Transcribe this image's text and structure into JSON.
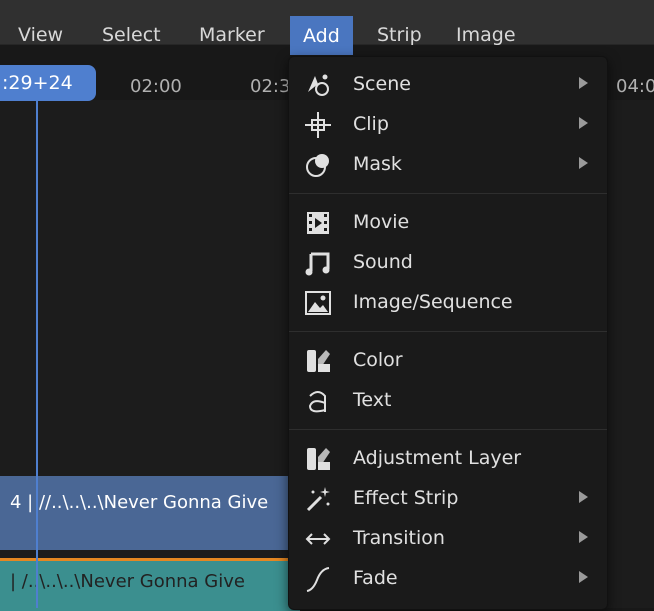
{
  "menubar": {
    "items": [
      "View",
      "Select",
      "Marker",
      "Add",
      "Strip",
      "Image"
    ],
    "active_index": 3
  },
  "timeline": {
    "playhead_time": ":29+24",
    "ticks": [
      "02:00",
      "02:3"
    ],
    "right_tick": "04:0"
  },
  "strips": {
    "movie_label": "4 | //..\\..\\..\\Never Gonna Give",
    "sound_label": "| /..\\..\\..\\Never Gonna Give"
  },
  "add_menu": {
    "groups": [
      [
        {
          "label": "Scene",
          "icon": "scene-icon",
          "submenu": true
        },
        {
          "label": "Clip",
          "icon": "clip-icon",
          "submenu": true
        },
        {
          "label": "Mask",
          "icon": "mask-icon",
          "submenu": true
        }
      ],
      [
        {
          "label": "Movie",
          "icon": "movie-icon",
          "submenu": false
        },
        {
          "label": "Sound",
          "icon": "sound-icon",
          "submenu": false
        },
        {
          "label": "Image/Sequence",
          "icon": "image-icon",
          "submenu": false
        }
      ],
      [
        {
          "label": "Color",
          "icon": "color-icon",
          "submenu": false
        },
        {
          "label": "Text",
          "icon": "text-icon",
          "submenu": false
        }
      ],
      [
        {
          "label": "Adjustment Layer",
          "icon": "adjustment-layer-icon",
          "submenu": false
        },
        {
          "label": "Effect Strip",
          "icon": "effect-strip-icon",
          "submenu": true
        },
        {
          "label": "Transition",
          "icon": "transition-icon",
          "submenu": true
        },
        {
          "label": "Fade",
          "icon": "fade-icon",
          "submenu": true
        }
      ]
    ]
  },
  "colors": {
    "accent": "#4a76c0",
    "movie_strip": "#4a6795",
    "sound_strip": "#3b8f8f",
    "sound_strip_border": "#e58722"
  }
}
